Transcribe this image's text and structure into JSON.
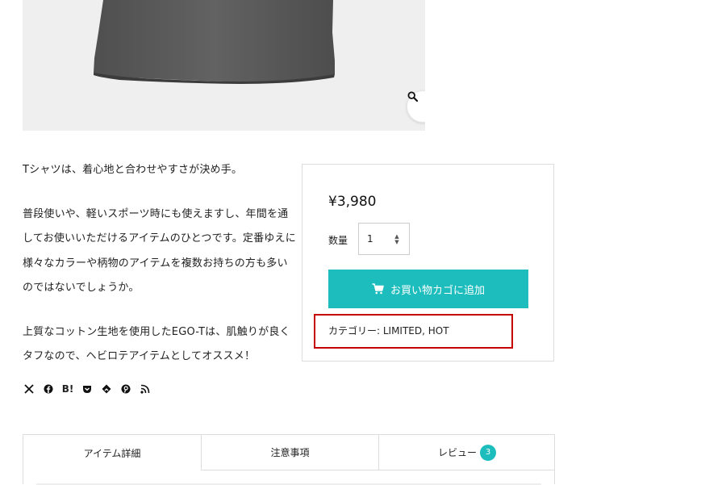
{
  "product": {
    "description": [
      "Tシャツは、着心地と合わせやすさが決め手。",
      "普段使いや、軽いスポーツ時にも使えますし、年間を通",
      "してお使いいただけるアイテムのひとつです。定番ゆえに",
      "様々なカラーや柄物のアイテムを複数お持ちの方も多い",
      "のではないでしょうか。",
      "上質なコットン生地を使用したEGO-Tは、肌触りが良く",
      "タフなので、ヘビロテアイテムとしてオススメ！"
    ]
  },
  "share": {
    "icons": [
      "x-icon",
      "facebook-icon",
      "hatena-bookmark-icon",
      "pocket-icon",
      "feedly-icon",
      "pinterest-icon",
      "rss-icon"
    ],
    "hatena_label": "B!"
  },
  "purchase": {
    "price": "¥3,980",
    "quantity_label": "数量",
    "quantity_value": "1",
    "add_to_cart_label": "お買い物カゴに追加",
    "category_text": "カテゴリー: LIMITED, HOT"
  },
  "tabs": [
    {
      "label": "アイテム詳細"
    },
    {
      "label": "注意事項"
    },
    {
      "label": "レビュー",
      "badge": "3"
    }
  ],
  "colors": {
    "accent": "#1ebdbd",
    "highlight": "#c40000",
    "shirt": "#5c5c5c",
    "image_bg": "#efefef"
  }
}
